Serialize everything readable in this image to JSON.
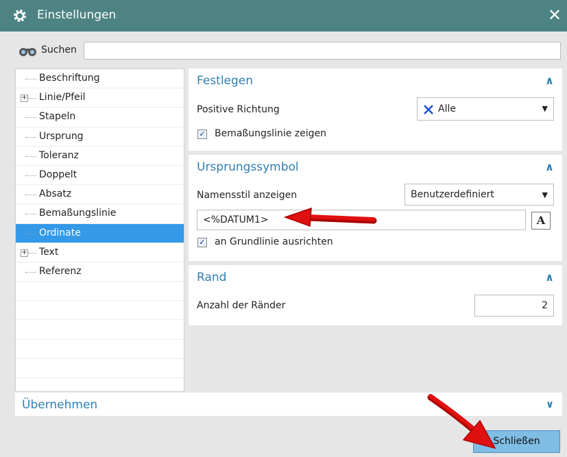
{
  "window": {
    "title": "Einstellungen"
  },
  "search": {
    "label": "Suchen",
    "value": ""
  },
  "tree": {
    "items": [
      {
        "label": "Beschriftung",
        "expandable": false,
        "selected": false
      },
      {
        "label": "Linie/Pfeil",
        "expandable": true,
        "selected": false
      },
      {
        "label": "Stapeln",
        "expandable": false,
        "selected": false
      },
      {
        "label": "Ursprung",
        "expandable": false,
        "selected": false
      },
      {
        "label": "Toleranz",
        "expandable": false,
        "selected": false
      },
      {
        "label": "Doppelt",
        "expandable": false,
        "selected": false
      },
      {
        "label": "Absatz",
        "expandable": false,
        "selected": false
      },
      {
        "label": "Bemaßungslinie",
        "expandable": false,
        "selected": false
      },
      {
        "label": "Ordinate",
        "expandable": false,
        "selected": true
      },
      {
        "label": "Text",
        "expandable": true,
        "selected": false
      },
      {
        "label": "Referenz",
        "expandable": false,
        "selected": false
      }
    ]
  },
  "festlegen": {
    "title": "Festlegen",
    "direction_label": "Positive Richtung",
    "direction_value": "Alle",
    "show_line_label": "Bemaßungslinie zeigen",
    "show_line_checked": true
  },
  "ursprung": {
    "title": "Ursprungssymbol",
    "name_style_label": "Namensstil anzeigen",
    "name_style_value": "Benutzerdefiniert",
    "text_value": "<%DATUM1>",
    "font_button": "A",
    "align_label": "an Grundlinie ausrichten",
    "align_checked": true
  },
  "rand": {
    "title": "Rand",
    "count_label": "Anzahl der Ränder",
    "count_value": "2"
  },
  "apply": {
    "title": "Übernehmen"
  },
  "buttons": {
    "close": "Schließen"
  },
  "icons": {
    "titlebar": "gear-icon",
    "search": "binoculars-icon",
    "direction": "cross-icon",
    "collapse": "chevron-up-icon",
    "expand": "chevron-down-icon"
  },
  "colors": {
    "titlebar": "#4e8383",
    "accent": "#2f7fb2",
    "selection": "#3399e8",
    "button": "#7fbde5",
    "annotation_arrow": "#e01010"
  }
}
